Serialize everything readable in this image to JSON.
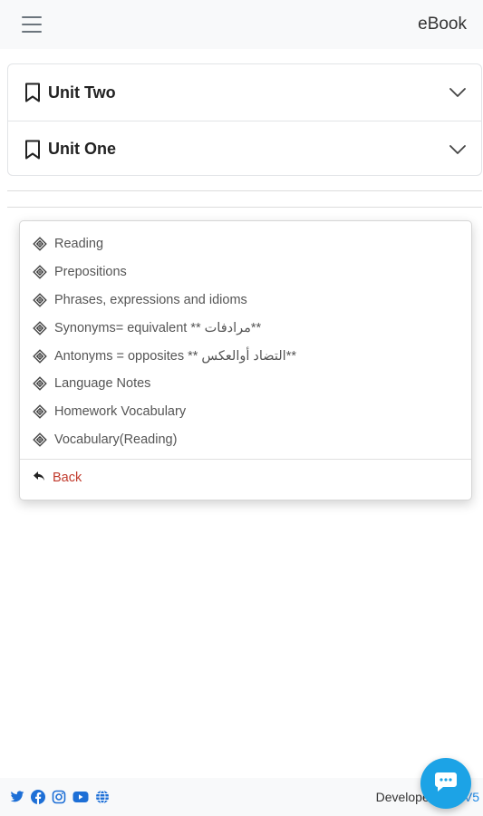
{
  "header": {
    "brand": "eBook",
    "menu_icon": "hamburger-icon"
  },
  "accordion": [
    {
      "title": "Unit Two",
      "icon": "bookmark-icon",
      "toggle_icon": "chevron-down-icon"
    },
    {
      "title": "Unit One",
      "icon": "bookmark-icon",
      "toggle_icon": "chevron-down-icon"
    }
  ],
  "dropdown": {
    "items": [
      {
        "label": "Reading"
      },
      {
        "label": "Prepositions"
      },
      {
        "label": "Phrases, expressions and idioms"
      },
      {
        "label": "Synonyms= equivalent ** مرادفات**"
      },
      {
        "label": "Antonyms = opposites ** التضاد أوالعكس**"
      },
      {
        "label": "Language Notes"
      },
      {
        "label": "Homework Vocabulary"
      },
      {
        "label": "Vocabulary(Reading)"
      }
    ],
    "item_icon": "diamond-icon",
    "back_label": "Back",
    "back_icon": "reply-arrow-icon"
  },
  "footer": {
    "socials": [
      "twitter-icon",
      "facebook-icon",
      "instagram-icon",
      "youtube-icon",
      "globe-icon"
    ],
    "developed_by": "Developed by",
    "developer": "..V5"
  },
  "colors": {
    "accent": "#1ca3e6",
    "back": "#c0392b",
    "topbar_bg": "#f8f9fa"
  }
}
